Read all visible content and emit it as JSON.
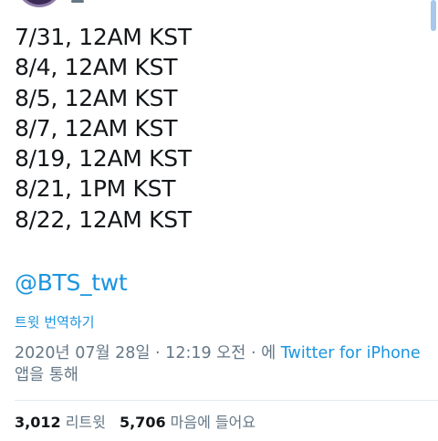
{
  "tweet": {
    "lines": [
      "7/31, 12AM KST",
      "8/4, 12AM KST",
      "8/5, 12AM KST",
      "8/7, 12AM KST",
      "8/19, 12AM KST",
      "8/21, 1PM KST",
      "8/22, 12AM KST"
    ],
    "mention": "@BTS_twt"
  },
  "translate_label": "트윗 번역하기",
  "meta": {
    "timestamp": "2020년 07월 28일 · 12:19 오전 · 에",
    "source": "Twitter for iPhone",
    "via_suffix": "앱을 통해"
  },
  "stats": {
    "retweets_count": "3,012",
    "retweets_label": "리트윗",
    "likes_count": "5,706",
    "likes_label": "마음에 들어요"
  },
  "colors": {
    "link": "#1b95e0",
    "muted": "#657786",
    "text": "#14171a"
  }
}
